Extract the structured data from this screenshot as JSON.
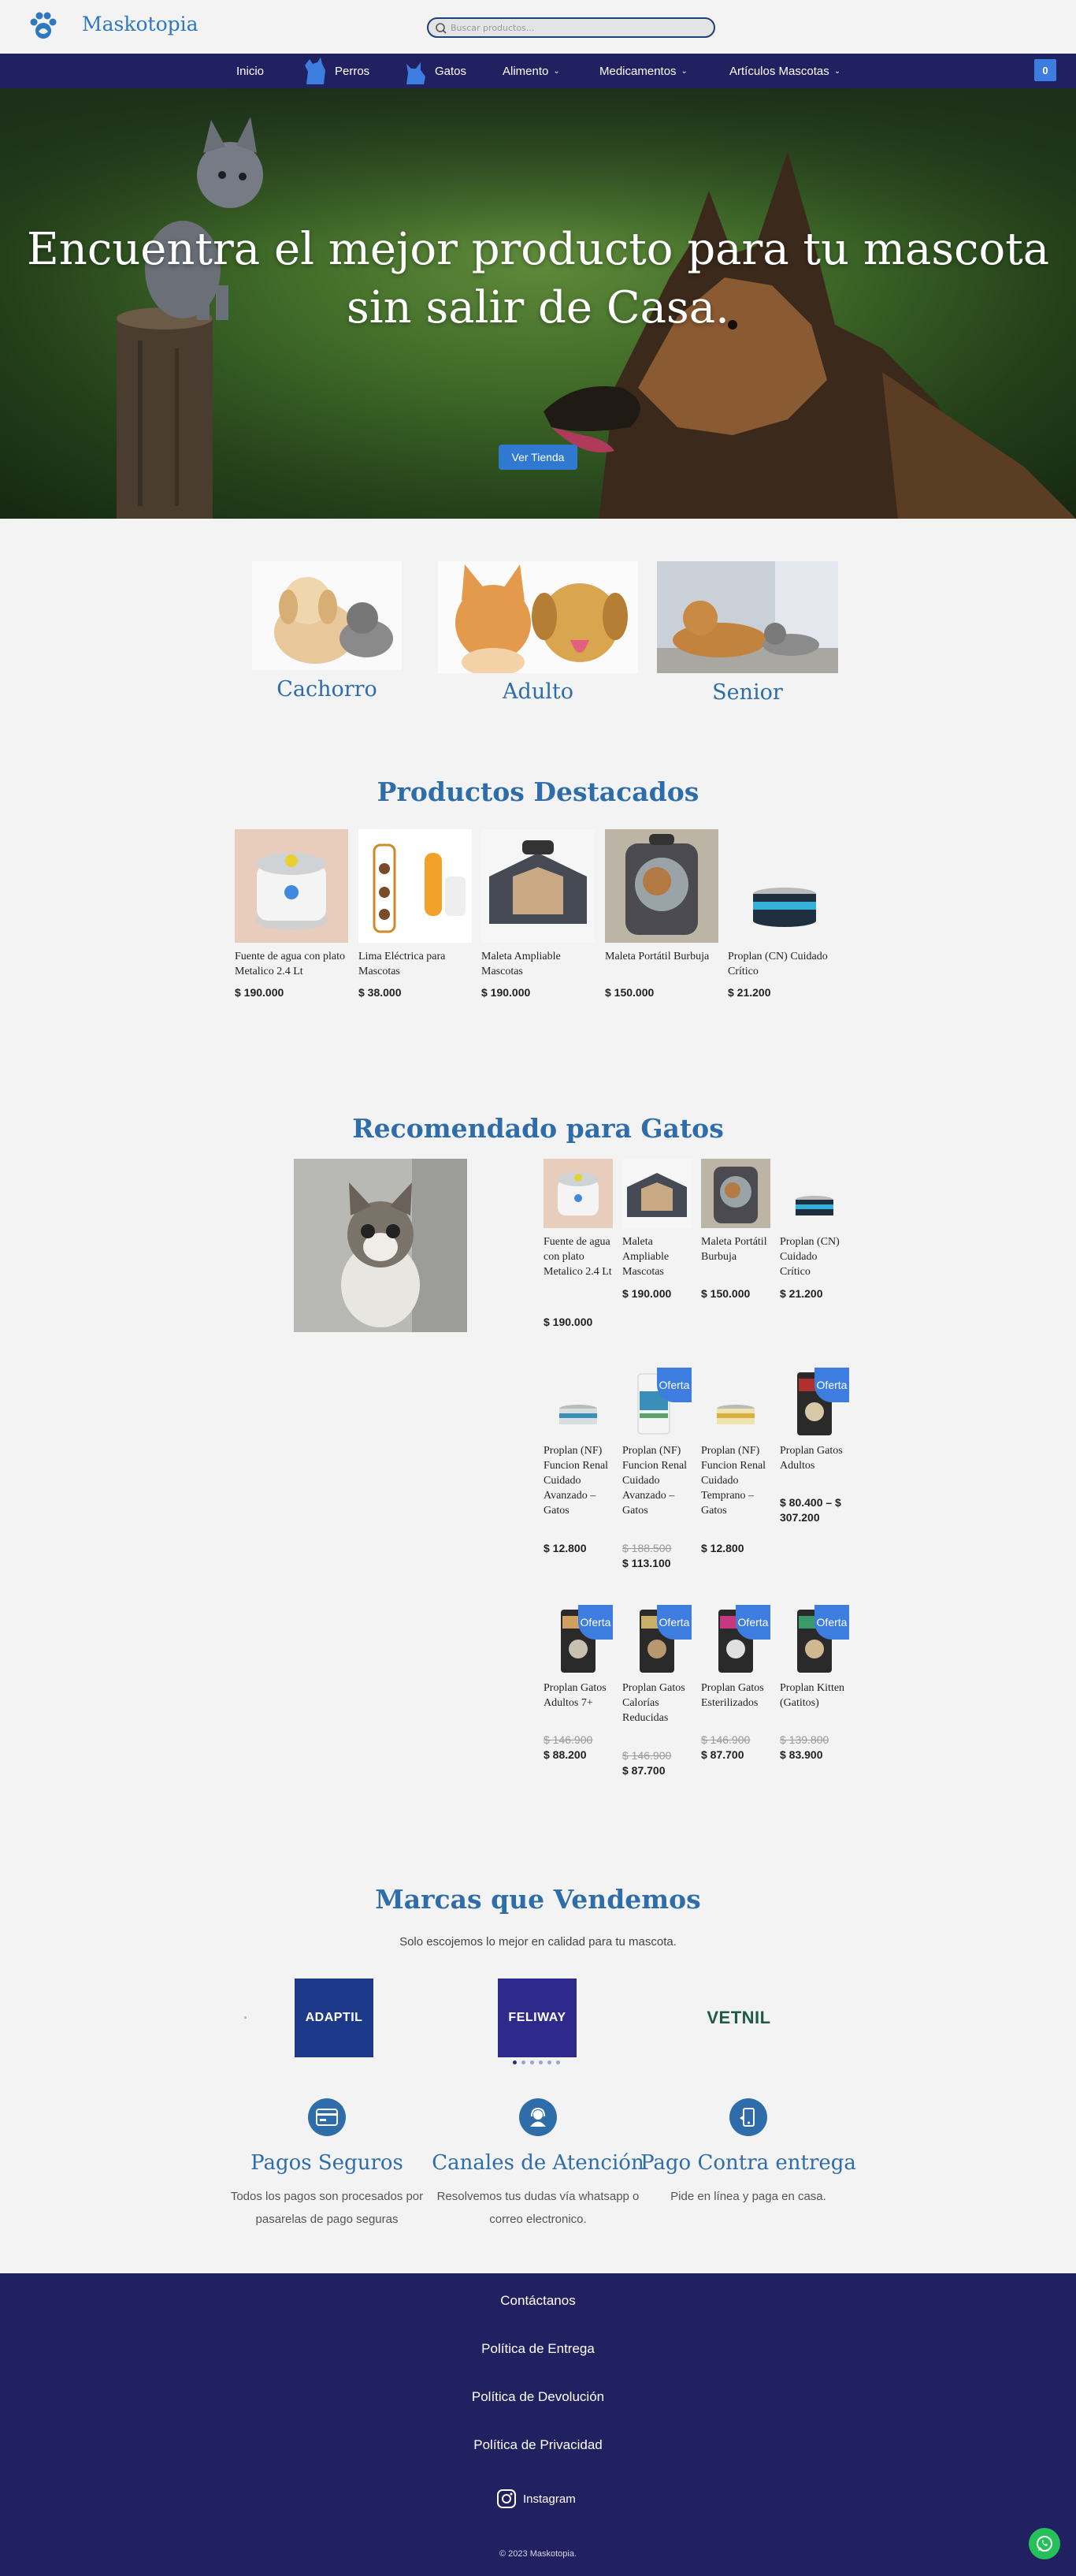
{
  "brand": {
    "name": "Maskotopia"
  },
  "search": {
    "placeholder": "Buscar productos..."
  },
  "nav": {
    "items": [
      {
        "label": "Inicio"
      },
      {
        "label": "Perros"
      },
      {
        "label": "Gatos"
      },
      {
        "label": "Alimento"
      },
      {
        "label": "Medicamentos"
      },
      {
        "label": "Artículos Mascotas"
      }
    ],
    "cart_count": "0"
  },
  "hero": {
    "title": "Encuentra el mejor producto para tu mascota sin salir de Casa.",
    "button": "Ver Tienda"
  },
  "age_categories": [
    {
      "label": "Cachorro"
    },
    {
      "label": "Adulto"
    },
    {
      "label": "Senior"
    }
  ],
  "featured": {
    "title": "Productos Destacados",
    "products": [
      {
        "name": "Fuente de agua con plato Metalico 2.4 Lt",
        "price": "$ 190.000"
      },
      {
        "name": "Lima Eléctrica para Mascotas",
        "price": "$ 38.000"
      },
      {
        "name": "Maleta Ampliable Mascotas",
        "price": "$ 190.000"
      },
      {
        "name": "Maleta Portátil Burbuja",
        "price": "$ 150.000"
      },
      {
        "name": "Proplan (CN) Cuidado Crítico",
        "price": "$ 21.200"
      }
    ]
  },
  "cats": {
    "title": "Recomendado para Gatos",
    "badge": "Oferta",
    "products": [
      {
        "name": "Fuente de agua con plato Metalico 2.4 Lt",
        "old_price": "",
        "price": "$ 190.000"
      },
      {
        "name": "Maleta Ampliable Mascotas",
        "old_price": "",
        "price": "$ 190.000"
      },
      {
        "name": "Maleta Portátil Burbuja",
        "old_price": "",
        "price": "$ 150.000"
      },
      {
        "name": "Proplan (CN) Cuidado Crítico",
        "old_price": "",
        "price": "$ 21.200"
      },
      {
        "name": "Proplan (NF) Funcion Renal Cuidado Avanzado – Gatos",
        "old_price": "",
        "price": "$ 12.800"
      },
      {
        "name": "Proplan (NF) Funcion Renal Cuidado Avanzado – Gatos",
        "old_price": "$ 188.500",
        "price": "$ 113.100"
      },
      {
        "name": "Proplan (NF) Funcion Renal Cuidado Temprano – Gatos",
        "old_price": "",
        "price": "$ 12.800"
      },
      {
        "name": "Proplan Gatos Adultos",
        "old_price": "",
        "price": "$ 80.400 – $ 307.200"
      },
      {
        "name": "Proplan Gatos Adultos 7+",
        "old_price": "$ 146.900",
        "price": "$ 88.200"
      },
      {
        "name": "Proplan Gatos Calorías Reducidas",
        "old_price": "$ 146.900",
        "price": "$ 87.700"
      },
      {
        "name": "Proplan Gatos Esterilizados",
        "old_price": "$ 146.900",
        "price": "$ 87.700"
      },
      {
        "name": "Proplan Kitten (Gatitos)",
        "old_price": "$ 139.800",
        "price": "$ 83.900"
      }
    ]
  },
  "brands": {
    "title": "Marcas que Vendemos",
    "subtitle": "Solo escojemos lo mejor en calidad para tu mascota.",
    "items": [
      {
        "label": "ADAPTIL",
        "color": "#1d3a8a"
      },
      {
        "label": "FELIWAY",
        "color": "#2d2a8c"
      },
      {
        "label": "VETNIL",
        "color": "#1e5a48"
      }
    ]
  },
  "features": [
    {
      "icon": "credit-card-icon",
      "title": "Pagos Seguros",
      "text": "Todos los pagos son procesados por pasarelas de pago seguras"
    },
    {
      "icon": "support-agent-icon",
      "title": "Canales de Atención",
      "text": "Resolvemos tus dudas vía whatsapp o correo electronico."
    },
    {
      "icon": "delivery-icon",
      "title": "Pago Contra entrega",
      "text": "Pide en línea y paga en casa."
    }
  ],
  "footer": {
    "links": [
      {
        "label": "Contáctanos"
      },
      {
        "label": "Política de Entrega"
      },
      {
        "label": "Política de Devolución"
      },
      {
        "label": "Política de Privacidad"
      }
    ],
    "instagram": "Instagram",
    "copyright": "© 2023 Maskotopia."
  },
  "colors": {
    "navy": "#212060",
    "accent": "#2e6da9",
    "button": "#3d7de0",
    "whatsapp": "#25c05a"
  }
}
